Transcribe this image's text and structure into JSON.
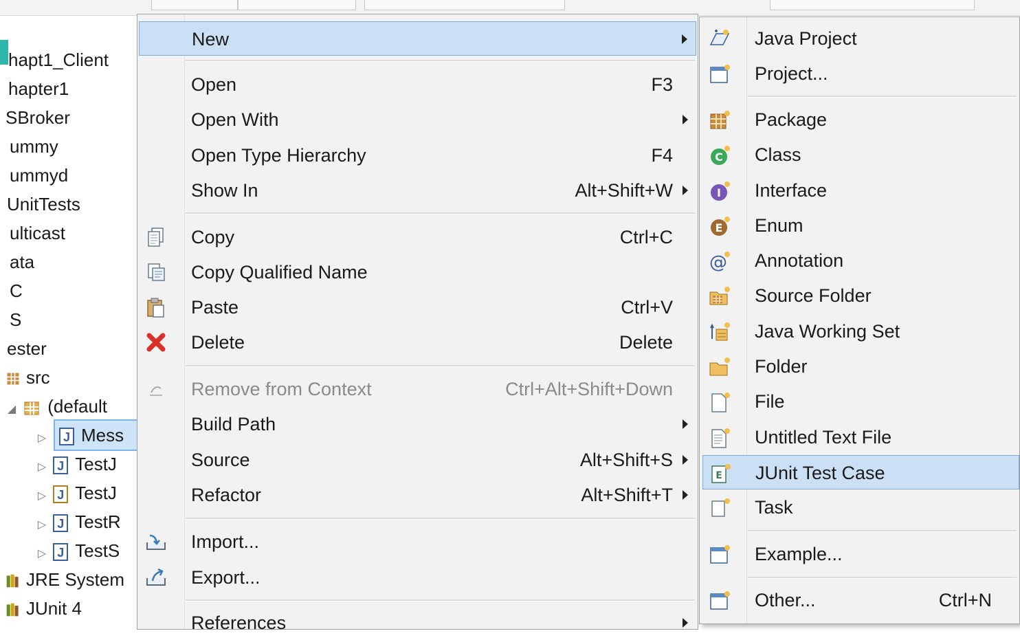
{
  "explorer": {
    "items": [
      {
        "label": "hapt1_Client"
      },
      {
        "label": "hapter1"
      },
      {
        "label": "SBroker"
      },
      {
        "label": "ummy"
      },
      {
        "label": "ummyd"
      },
      {
        "label": "UnitTests"
      },
      {
        "label": "ulticast"
      },
      {
        "label": "ata"
      },
      {
        "label": "C"
      },
      {
        "label": "S"
      },
      {
        "label": "ester"
      },
      {
        "label": "src"
      },
      {
        "label": "(default"
      },
      {
        "label": "Mess"
      },
      {
        "label": "TestJ"
      },
      {
        "label": "TestJ"
      },
      {
        "label": "TestR"
      },
      {
        "label": "TestS"
      },
      {
        "label": "JRE System"
      },
      {
        "label": "JUnit 4"
      }
    ]
  },
  "menu": {
    "items": [
      {
        "label": "New",
        "shortcut": "",
        "submenu": true,
        "icon": ""
      },
      {
        "label": "Open",
        "shortcut": "F3",
        "submenu": false,
        "icon": ""
      },
      {
        "label": "Open With",
        "shortcut": "",
        "submenu": true,
        "icon": ""
      },
      {
        "label": "Open Type Hierarchy",
        "shortcut": "F4",
        "submenu": false,
        "icon": ""
      },
      {
        "label": "Show In",
        "shortcut": "Alt+Shift+W",
        "submenu": true,
        "icon": ""
      },
      {
        "label": "Copy",
        "shortcut": "Ctrl+C",
        "submenu": false,
        "icon": "copy-icon"
      },
      {
        "label": "Copy Qualified Name",
        "shortcut": "",
        "submenu": false,
        "icon": "copy-qualified-name-icon"
      },
      {
        "label": "Paste",
        "shortcut": "Ctrl+V",
        "submenu": false,
        "icon": "paste-icon"
      },
      {
        "label": "Delete",
        "shortcut": "Delete",
        "submenu": false,
        "icon": "delete-icon"
      },
      {
        "label": "Remove from Context",
        "shortcut": "Ctrl+Alt+Shift+Down",
        "submenu": false,
        "icon": "remove-context-icon",
        "disabled": true
      },
      {
        "label": "Build Path",
        "shortcut": "",
        "submenu": true,
        "icon": ""
      },
      {
        "label": "Source",
        "shortcut": "Alt+Shift+S",
        "submenu": true,
        "icon": ""
      },
      {
        "label": "Refactor",
        "shortcut": "Alt+Shift+T",
        "submenu": true,
        "icon": ""
      },
      {
        "label": "Import...",
        "shortcut": "",
        "submenu": false,
        "icon": "import-icon"
      },
      {
        "label": "Export...",
        "shortcut": "",
        "submenu": false,
        "icon": "export-icon"
      },
      {
        "label": "References",
        "shortcut": "",
        "submenu": true,
        "icon": ""
      }
    ]
  },
  "submenu": {
    "items": [
      {
        "label": "Java Project",
        "shortcut": "",
        "icon": "java-project-icon"
      },
      {
        "label": "Project...",
        "shortcut": "",
        "icon": "project-icon"
      },
      {
        "label": "Package",
        "shortcut": "",
        "icon": "package-icon"
      },
      {
        "label": "Class",
        "shortcut": "",
        "icon": "class-icon"
      },
      {
        "label": "Interface",
        "shortcut": "",
        "icon": "interface-icon"
      },
      {
        "label": "Enum",
        "shortcut": "",
        "icon": "enum-icon"
      },
      {
        "label": "Annotation",
        "shortcut": "",
        "icon": "annotation-icon"
      },
      {
        "label": "Source Folder",
        "shortcut": "",
        "icon": "source-folder-icon"
      },
      {
        "label": "Java Working Set",
        "shortcut": "",
        "icon": "java-working-set-icon"
      },
      {
        "label": "Folder",
        "shortcut": "",
        "icon": "folder-icon"
      },
      {
        "label": "File",
        "shortcut": "",
        "icon": "file-icon"
      },
      {
        "label": "Untitled Text File",
        "shortcut": "",
        "icon": "untitled-text-file-icon"
      },
      {
        "label": "JUnit Test Case",
        "shortcut": "",
        "icon": "junit-test-case-icon"
      },
      {
        "label": "Task",
        "shortcut": "",
        "icon": "task-icon"
      },
      {
        "label": "Example...",
        "shortcut": "",
        "icon": "example-icon"
      },
      {
        "label": "Other...",
        "shortcut": "Ctrl+N",
        "icon": "other-icon"
      }
    ]
  },
  "colors": {
    "highlight": "#cce0f5",
    "highlight_border": "#7ea9d9",
    "menu_bg": "#f2f2f2",
    "delete_red": "#d9302a",
    "class_green": "#3aa85a",
    "interface_purple": "#7a55b8",
    "enum_brown": "#a0692e"
  }
}
